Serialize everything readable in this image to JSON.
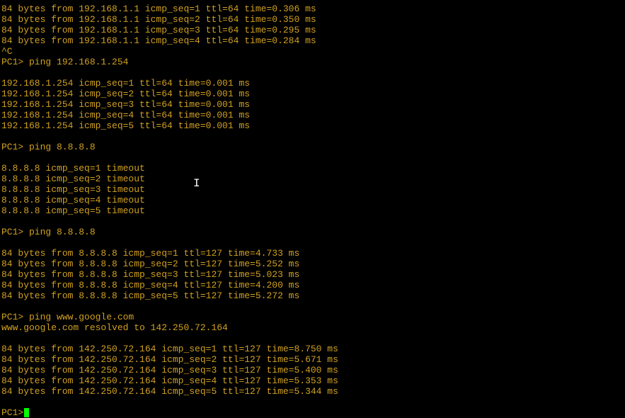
{
  "lines": [
    {
      "t": "text",
      "v": "84 bytes from 192.168.1.1 icmp_seq=1 ttl=64 time=0.306 ms"
    },
    {
      "t": "text",
      "v": "84 bytes from 192.168.1.1 icmp_seq=2 ttl=64 time=0.350 ms"
    },
    {
      "t": "text",
      "v": "84 bytes from 192.168.1.1 icmp_seq=3 ttl=64 time=0.295 ms"
    },
    {
      "t": "text",
      "v": "84 bytes from 192.168.1.1 icmp_seq=4 ttl=64 time=0.284 ms"
    },
    {
      "t": "text",
      "v": "^C"
    },
    {
      "t": "text",
      "v": "PC1> ping 192.168.1.254"
    },
    {
      "t": "blank"
    },
    {
      "t": "text",
      "v": "192.168.1.254 icmp_seq=1 ttl=64 time=0.001 ms"
    },
    {
      "t": "text",
      "v": "192.168.1.254 icmp_seq=2 ttl=64 time=0.001 ms"
    },
    {
      "t": "text",
      "v": "192.168.1.254 icmp_seq=3 ttl=64 time=0.001 ms"
    },
    {
      "t": "text",
      "v": "192.168.1.254 icmp_seq=4 ttl=64 time=0.001 ms"
    },
    {
      "t": "text",
      "v": "192.168.1.254 icmp_seq=5 ttl=64 time=0.001 ms"
    },
    {
      "t": "blank"
    },
    {
      "t": "text",
      "v": "PC1> ping 8.8.8.8"
    },
    {
      "t": "blank"
    },
    {
      "t": "text",
      "v": "8.8.8.8 icmp_seq=1 timeout"
    },
    {
      "t": "text",
      "v": "8.8.8.8 icmp_seq=2 timeout"
    },
    {
      "t": "text",
      "v": "8.8.8.8 icmp_seq=3 timeout"
    },
    {
      "t": "text",
      "v": "8.8.8.8 icmp_seq=4 timeout"
    },
    {
      "t": "text",
      "v": "8.8.8.8 icmp_seq=5 timeout"
    },
    {
      "t": "blank"
    },
    {
      "t": "text",
      "v": "PC1> ping 8.8.8.8"
    },
    {
      "t": "blank"
    },
    {
      "t": "text",
      "v": "84 bytes from 8.8.8.8 icmp_seq=1 ttl=127 time=4.733 ms"
    },
    {
      "t": "text",
      "v": "84 bytes from 8.8.8.8 icmp_seq=2 ttl=127 time=5.252 ms"
    },
    {
      "t": "text",
      "v": "84 bytes from 8.8.8.8 icmp_seq=3 ttl=127 time=5.023 ms"
    },
    {
      "t": "text",
      "v": "84 bytes from 8.8.8.8 icmp_seq=4 ttl=127 time=4.200 ms"
    },
    {
      "t": "text",
      "v": "84 bytes from 8.8.8.8 icmp_seq=5 ttl=127 time=5.272 ms"
    },
    {
      "t": "blank"
    },
    {
      "t": "text",
      "v": "PC1> ping www.google.com"
    },
    {
      "t": "text",
      "v": "www.google.com resolved to 142.250.72.164"
    },
    {
      "t": "blank"
    },
    {
      "t": "text",
      "v": "84 bytes from 142.250.72.164 icmp_seq=1 ttl=127 time=8.750 ms"
    },
    {
      "t": "text",
      "v": "84 bytes from 142.250.72.164 icmp_seq=2 ttl=127 time=5.671 ms"
    },
    {
      "t": "text",
      "v": "84 bytes from 142.250.72.164 icmp_seq=3 ttl=127 time=5.400 ms"
    },
    {
      "t": "text",
      "v": "84 bytes from 142.250.72.164 icmp_seq=4 ttl=127 time=5.353 ms"
    },
    {
      "t": "text",
      "v": "84 bytes from 142.250.72.164 icmp_seq=5 ttl=127 time=5.344 ms"
    },
    {
      "t": "blank"
    }
  ],
  "prompt": "PC1> ",
  "cursor_glyph": "I"
}
